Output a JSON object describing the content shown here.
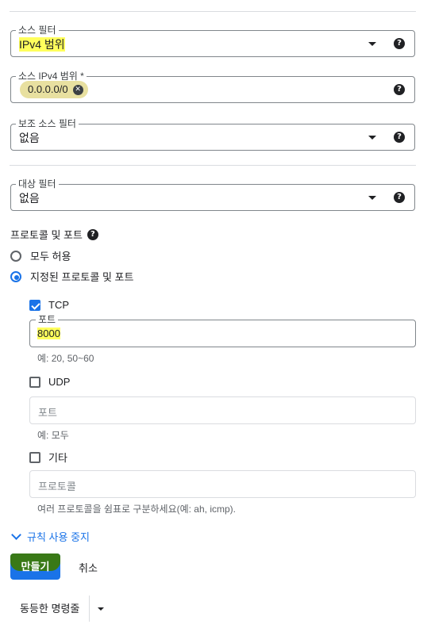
{
  "source_filter": {
    "label": "소스 필터",
    "value": "IPv4 범위"
  },
  "source_ipv4": {
    "label": "소스 IPv4 범위 *",
    "chip": "0.0.0.0/0"
  },
  "secondary_filter": {
    "label": "보조 소스 필터",
    "value": "없음"
  },
  "target_filter": {
    "label": "대상 필터",
    "value": "없음"
  },
  "protocols": {
    "title": "프로토콜 및 포트",
    "allow_all": "모두 허용",
    "specified": "지정된 프로토콜 및 포트",
    "tcp": {
      "label": "TCP",
      "checked": true,
      "port_label": "포트",
      "port_value": "8000",
      "hint": "예: 20, 50~60"
    },
    "udp": {
      "label": "UDP",
      "checked": false,
      "placeholder": "포트",
      "hint": "예: 모두"
    },
    "other": {
      "label": "기타",
      "checked": false,
      "placeholder": "프로토콜",
      "hint": "여러 프로토콜을 쉼표로 구분하세요(예: ah, icmp)."
    }
  },
  "disable_rule": "규칙 사용 중지",
  "actions": {
    "create": "만들기",
    "cancel": "취소",
    "equivalent": "동등한 명령줄"
  },
  "colors": {
    "accent": "#1a73e8",
    "highlight": "#ffff5c"
  },
  "icons": {
    "help": "help-icon",
    "dropdown": "caret-down-icon",
    "clear": "clear-chip-icon",
    "expand": "chevron-down-icon"
  }
}
